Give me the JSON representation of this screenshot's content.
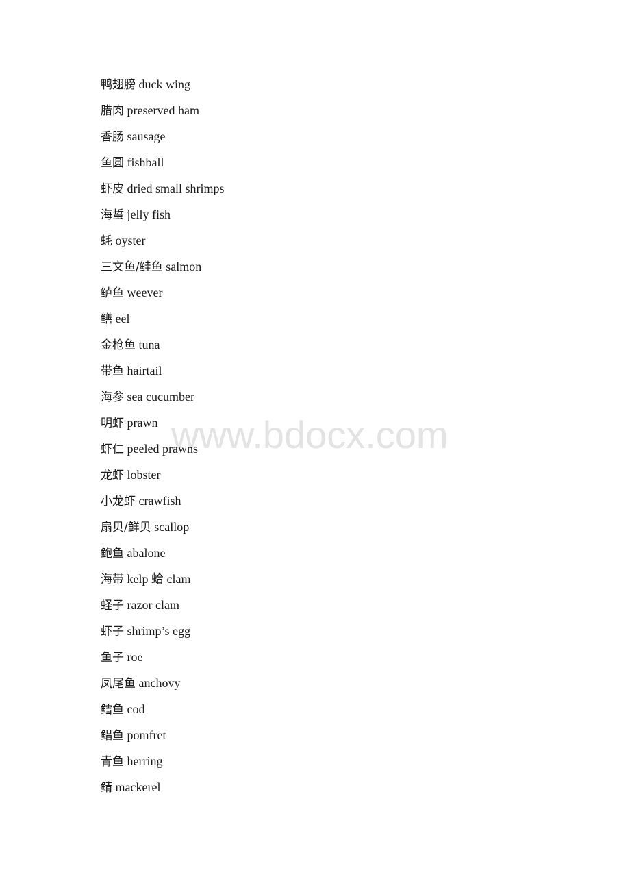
{
  "document": {
    "watermark": "www.bdocx.com",
    "entries": [
      {
        "zh": "鸭翅膀",
        "en": "duck wing"
      },
      {
        "zh": "腊肉",
        "en": "preserved ham"
      },
      {
        "zh": "香肠",
        "en": "sausage"
      },
      {
        "zh": "鱼圆",
        "en": "fishball"
      },
      {
        "zh": "虾皮",
        "en": "dried small shrimps"
      },
      {
        "zh": "海蜇",
        "en": "jelly fish"
      },
      {
        "zh": "蚝",
        "en": "oyster"
      },
      {
        "zh": "三文鱼/鲑鱼",
        "en": "salmon"
      },
      {
        "zh": "鲈鱼",
        "en": "weever"
      },
      {
        "zh": "鳝",
        "en": "eel"
      },
      {
        "zh": "金枪鱼",
        "en": "tuna"
      },
      {
        "zh": "带鱼",
        "en": "hairtail"
      },
      {
        "zh": "海参",
        "en": "sea cucumber"
      },
      {
        "zh": "明虾",
        "en": "prawn"
      },
      {
        "zh": "虾仁",
        "en": "peeled prawns"
      },
      {
        "zh": "龙虾",
        "en": "lobster"
      },
      {
        "zh": "小龙虾",
        "en": "crawfish"
      },
      {
        "zh": "扇贝/鲜贝",
        "en": "scallop"
      },
      {
        "zh": "鲍鱼",
        "en": "abalone"
      },
      {
        "zh": "海带",
        "en": "kelp 蛤 clam"
      },
      {
        "zh": "蛏子",
        "en": "razor clam"
      },
      {
        "zh": "虾子",
        "en": "shrimp’s egg"
      },
      {
        "zh": "鱼子",
        "en": "roe"
      },
      {
        "zh": "凤尾鱼",
        "en": "anchovy"
      },
      {
        "zh": "鳕鱼",
        "en": "cod"
      },
      {
        "zh": "鲳鱼",
        "en": "pomfret"
      },
      {
        "zh": "青鱼",
        "en": "herring"
      },
      {
        "zh": "鲭",
        "en": "mackerel"
      }
    ]
  }
}
